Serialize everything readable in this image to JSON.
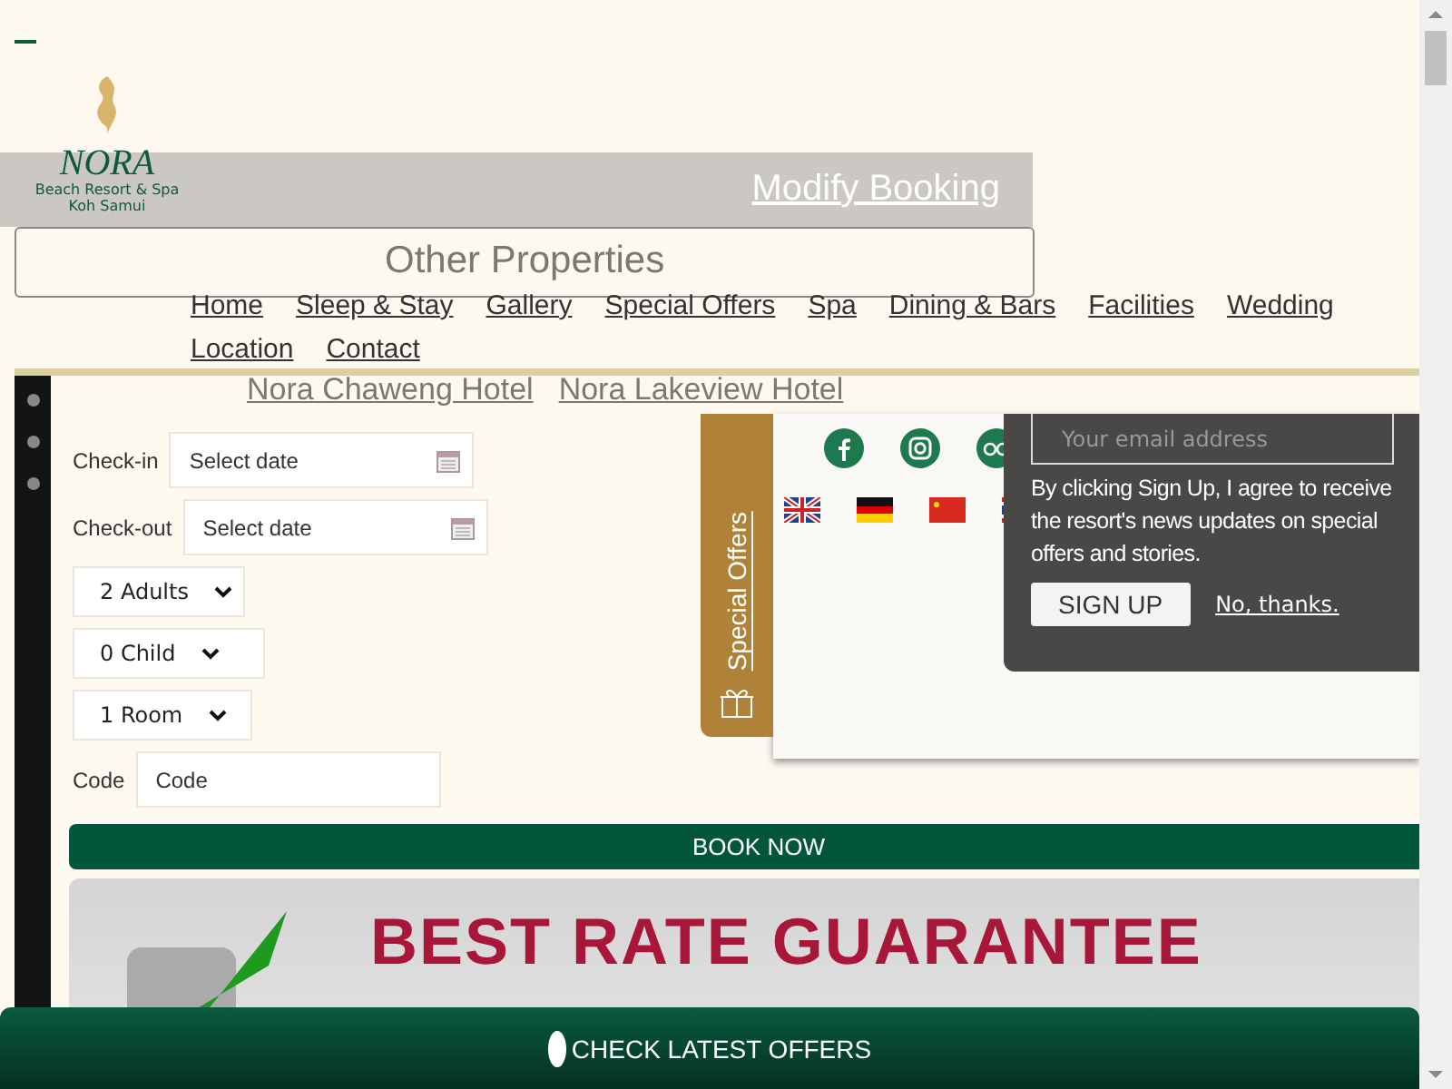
{
  "logo": {
    "name": "NORA",
    "tagline": "Beach Resort & Spa",
    "location": "Koh Samui"
  },
  "modify_booking": "Modify Booking",
  "other_properties": {
    "title": "Other Properties",
    "links": [
      "Nora Chaweng Hotel",
      "Nora Lakeview Hotel"
    ]
  },
  "nav": [
    "Home",
    "Sleep & Stay",
    "Gallery",
    "Special Offers",
    "Spa",
    "Dining & Bars",
    "Facilities",
    "Wedding",
    "Location",
    "Contact"
  ],
  "booking_form": {
    "dates": [
      {
        "label": "Check-in",
        "placeholder": "Select date"
      },
      {
        "label": "Check-out",
        "placeholder": "Select date"
      }
    ],
    "selects": [
      "2 Adults",
      "0 Child",
      "1 Room"
    ],
    "code": {
      "label": "Code",
      "placeholder": "Code"
    },
    "submit": "BOOK NOW"
  },
  "special_offers_tab": "Special Offers",
  "newsletter": {
    "placeholder": "Your email address",
    "consent": "By clicking Sign Up, I agree to receive the resort's news updates on special offers and stories.",
    "sign_up": "SIGN UP",
    "decline": "No, thanks."
  },
  "banner": "BEST RATE GUARANTEE",
  "offers_bar": "CHECK LATEST OFFERS"
}
